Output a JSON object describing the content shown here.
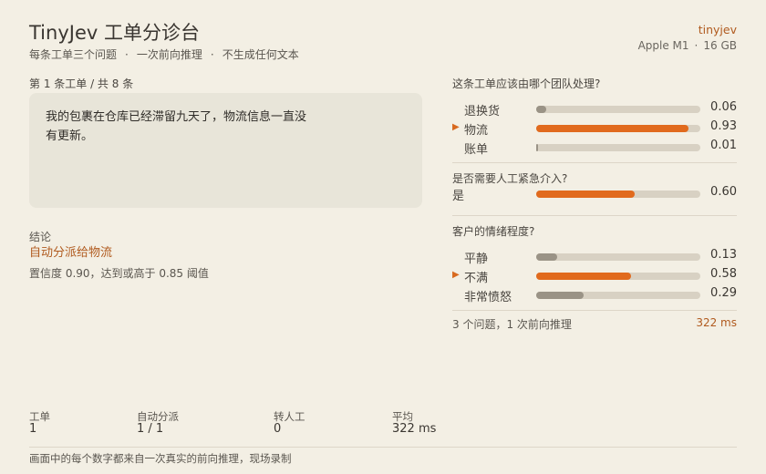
{
  "header": {
    "title": "TinyJev 工单分诊台",
    "subtitle_parts": [
      "每条工单三个问题",
      "一次前向推理",
      "不生成任何文本"
    ],
    "subtitle_sep": "·",
    "brand": "tinyjev",
    "device": "Apple M1",
    "device_sep": "·",
    "memory": "16 GB"
  },
  "ticket": {
    "counter": "第 1 条工单 / 共 8 条",
    "text": "我的包裹在仓库已经滞留九天了，物流信息一直没有更新。"
  },
  "result": {
    "label": "结论",
    "decision": "自动分派给物流",
    "confidence": "置信度 0.90，达到或高于 0.85 阈值"
  },
  "questions": [
    {
      "question": "这条工单应该由哪个团队处理?",
      "options": [
        {
          "label": "退换货",
          "value": 0.06,
          "value_text": "0.06",
          "selected": false
        },
        {
          "label": "物流",
          "value": 0.93,
          "value_text": "0.93",
          "selected": true
        },
        {
          "label": "账单",
          "value": 0.01,
          "value_text": "0.01",
          "selected": false
        }
      ]
    },
    {
      "question": "是否需要人工紧急介入?",
      "options": [
        {
          "label": "是",
          "value": 0.6,
          "value_text": "0.60",
          "selected": true
        }
      ]
    },
    {
      "question": "客户的情绪程度?",
      "options": [
        {
          "label": "平静",
          "value": 0.13,
          "value_text": "0.13",
          "selected": false
        },
        {
          "label": "不满",
          "value": 0.58,
          "value_text": "0.58",
          "selected": true
        },
        {
          "label": "非常愤怒",
          "value": 0.29,
          "value_text": "0.29",
          "selected": false
        }
      ]
    }
  ],
  "summary": {
    "text": "3 个问题，1 次前向推理",
    "latency": "322 ms"
  },
  "stats": [
    {
      "label": "工单",
      "value": "1"
    },
    {
      "label": "自动分派",
      "value": "1 / 1"
    },
    {
      "label": "转人工",
      "value": "0"
    },
    {
      "label": "平均",
      "value": "322 ms"
    }
  ],
  "footer": "画面中的每个数字都来自一次真实的前向推理，现场录制",
  "colors": {
    "accent": "#e16a1d",
    "accent_text": "#b05a1e",
    "bar_track": "#d8d1c3",
    "bar_dim": "#9a9386",
    "background": "#f3efe4"
  }
}
